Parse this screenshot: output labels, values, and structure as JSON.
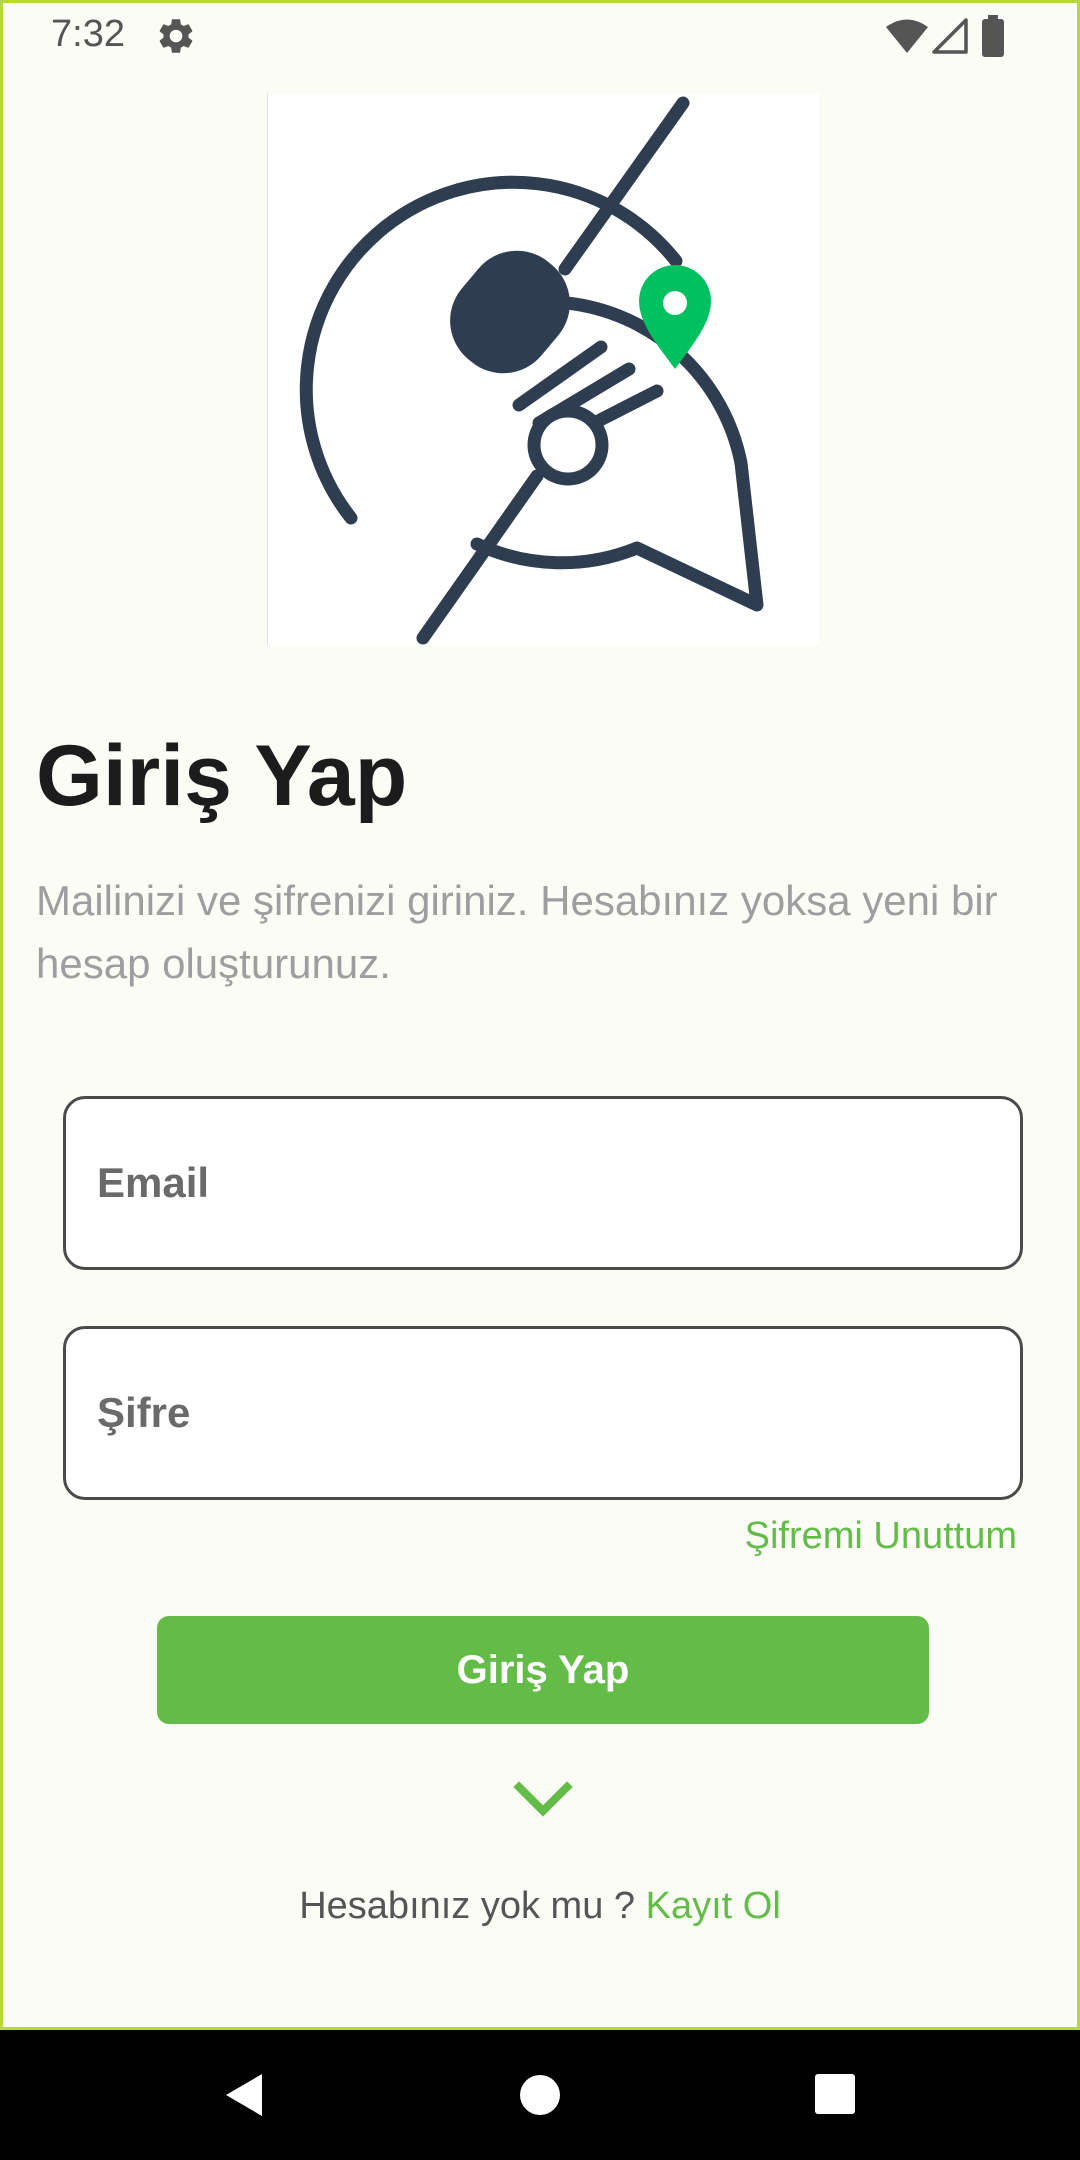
{
  "status_bar": {
    "time": "7:32",
    "icons": [
      "settings-icon",
      "wifi-icon",
      "signal-icon",
      "battery-icon"
    ]
  },
  "logo": {
    "icon": "fork-spoon-location-chat-icon",
    "colors": {
      "primary": "#2e3e50",
      "pin": "#00c060"
    }
  },
  "login": {
    "title": "Giriş Yap",
    "subtitle": "Mailinizi ve şifrenizi giriniz. Hesabınız yoksa yeni bir hesap oluşturunuz.",
    "email_placeholder": "Email",
    "password_placeholder": "Şifre",
    "forgot_password": "Şifremi Unuttum",
    "submit_label": "Giriş Yap",
    "expand_icon": "chevron-down-icon",
    "signup_question": "Hesabınız yok mu ? ",
    "signup_link": "Kayıt Ol"
  },
  "nav_bar": {
    "icons": [
      "back-icon",
      "home-icon",
      "recents-icon"
    ]
  },
  "colors": {
    "accent": "#62bc47",
    "background": "#fcfcf6",
    "frame_border": "#b6d93a",
    "title_text": "#1c1c1c",
    "subtitle_text": "#9e9e9e"
  }
}
